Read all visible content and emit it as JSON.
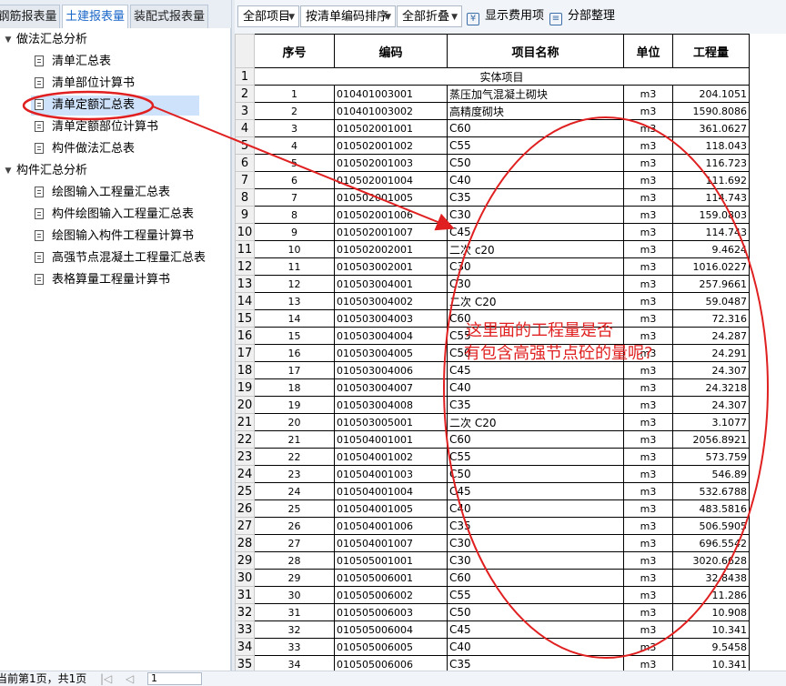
{
  "tabs": [
    "钢筋报表量",
    "土建报表量",
    "装配式报表量"
  ],
  "tree": {
    "group1": "做法汇总分析",
    "group1_items": [
      "清单汇总表",
      "清单部位计算书",
      "清单定额汇总表",
      "清单定额部位计算书",
      "构件做法汇总表"
    ],
    "group2": "构件汇总分析",
    "group2_items": [
      "绘图输入工程量汇总表",
      "构件绘图输入工程量汇总表",
      "绘图输入构件工程量计算书",
      "高强节点混凝土工程量汇总表",
      "表格算量工程量计算书"
    ]
  },
  "toolbar": {
    "scope": "全部项目",
    "sort": "按清单编码排序",
    "fold": "全部折叠",
    "show_fee": "显示费用项",
    "section": "分部整理"
  },
  "table": {
    "headers": [
      "序号",
      "编码",
      "项目名称",
      "单位",
      "工程量"
    ],
    "section_title": "实体项目",
    "rows": [
      [
        "1",
        "010401003001",
        "蒸压加气混凝土砌块",
        "m3",
        "204.1051"
      ],
      [
        "2",
        "010401003002",
        "高精度砌块",
        "m3",
        "1590.8086"
      ],
      [
        "3",
        "010502001001",
        "C60",
        "m3",
        "361.0627"
      ],
      [
        "4",
        "010502001002",
        "C55",
        "m3",
        "118.043"
      ],
      [
        "5",
        "010502001003",
        "C50",
        "m3",
        "116.723"
      ],
      [
        "6",
        "010502001004",
        "C40",
        "m3",
        "111.692"
      ],
      [
        "7",
        "010502001005",
        "C35",
        "m3",
        "114.743"
      ],
      [
        "8",
        "010502001006",
        "C30",
        "m3",
        "159.0803"
      ],
      [
        "9",
        "010502001007",
        "C45",
        "m3",
        "114.743"
      ],
      [
        "10",
        "010502002001",
        "二次 c20",
        "m3",
        "9.4624"
      ],
      [
        "11",
        "010503002001",
        "C30",
        "m3",
        "1016.0227"
      ],
      [
        "12",
        "010503004001",
        "C30",
        "m3",
        "257.9661"
      ],
      [
        "13",
        "010503004002",
        "二次 C20",
        "m3",
        "59.0487"
      ],
      [
        "14",
        "010503004003",
        "C60",
        "m3",
        "72.316"
      ],
      [
        "15",
        "010503004004",
        "C55",
        "m3",
        "24.287"
      ],
      [
        "16",
        "010503004005",
        "C50",
        "m3",
        "24.291"
      ],
      [
        "17",
        "010503004006",
        "C45",
        "m3",
        "24.307"
      ],
      [
        "18",
        "010503004007",
        "C40",
        "m3",
        "24.3218"
      ],
      [
        "19",
        "010503004008",
        "C35",
        "m3",
        "24.307"
      ],
      [
        "20",
        "010503005001",
        "二次 C20",
        "m3",
        "3.1077"
      ],
      [
        "21",
        "010504001001",
        "C60",
        "m3",
        "2056.8921"
      ],
      [
        "22",
        "010504001002",
        "C55",
        "m3",
        "573.759"
      ],
      [
        "23",
        "010504001003",
        "C50",
        "m3",
        "546.89"
      ],
      [
        "24",
        "010504001004",
        "C45",
        "m3",
        "532.6788"
      ],
      [
        "25",
        "010504001005",
        "C40",
        "m3",
        "483.5816"
      ],
      [
        "26",
        "010504001006",
        "C35",
        "m3",
        "506.5905"
      ],
      [
        "27",
        "010504001007",
        "C30",
        "m3",
        "696.5542"
      ],
      [
        "28",
        "010505001001",
        "C30",
        "m3",
        "3020.6628"
      ],
      [
        "29",
        "010505006001",
        "C60",
        "m3",
        "32.8438"
      ],
      [
        "30",
        "010505006002",
        "C55",
        "m3",
        "11.286"
      ],
      [
        "31",
        "010505006003",
        "C50",
        "m3",
        "10.908"
      ],
      [
        "32",
        "010505006004",
        "C45",
        "m3",
        "10.341"
      ],
      [
        "33",
        "010505006005",
        "C40",
        "m3",
        "9.5458"
      ],
      [
        "34",
        "010505006006",
        "C35",
        "m3",
        "10.341"
      ]
    ]
  },
  "status": {
    "page_text": "当前第1页，共1页",
    "page_input": "1"
  },
  "annotation": {
    "line1": "这里面的工程量是否",
    "line2": "有包含高强节点砼的量呢?",
    "color": "#e02020"
  }
}
